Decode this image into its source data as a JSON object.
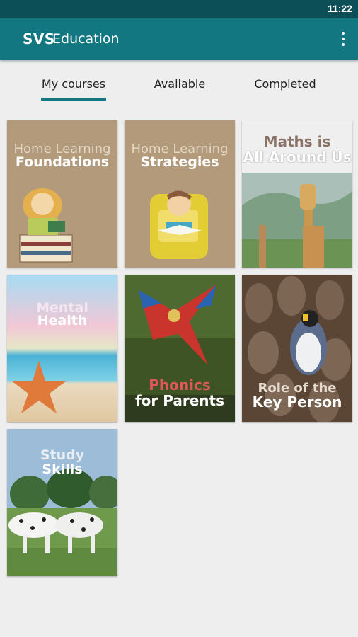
{
  "status": {
    "time": "11:22"
  },
  "appbar": {
    "brand": "SVS",
    "title": "Education",
    "menu_icon": "more-vert-icon"
  },
  "tabs": [
    {
      "label": "My courses",
      "active": true
    },
    {
      "label": "Available",
      "active": false
    },
    {
      "label": "Completed",
      "active": false
    }
  ],
  "colors": {
    "appbar": "#137781",
    "statusbar": "#0d4f57",
    "accent": "#137781",
    "background": "#eeeeee"
  },
  "courses": [
    {
      "line1": "Home Learning",
      "line2": "Foundations"
    },
    {
      "line1": "Home Learning",
      "line2": "Strategies"
    },
    {
      "line1": "Maths is",
      "line2": "All Around Us"
    },
    {
      "line1": "Mental",
      "line2": "Health"
    },
    {
      "line1": "Phonics",
      "line2": "for Parents"
    },
    {
      "line1": "Role of the",
      "line2": "Key Person"
    },
    {
      "line1": "Study",
      "line2": "Skills"
    }
  ]
}
